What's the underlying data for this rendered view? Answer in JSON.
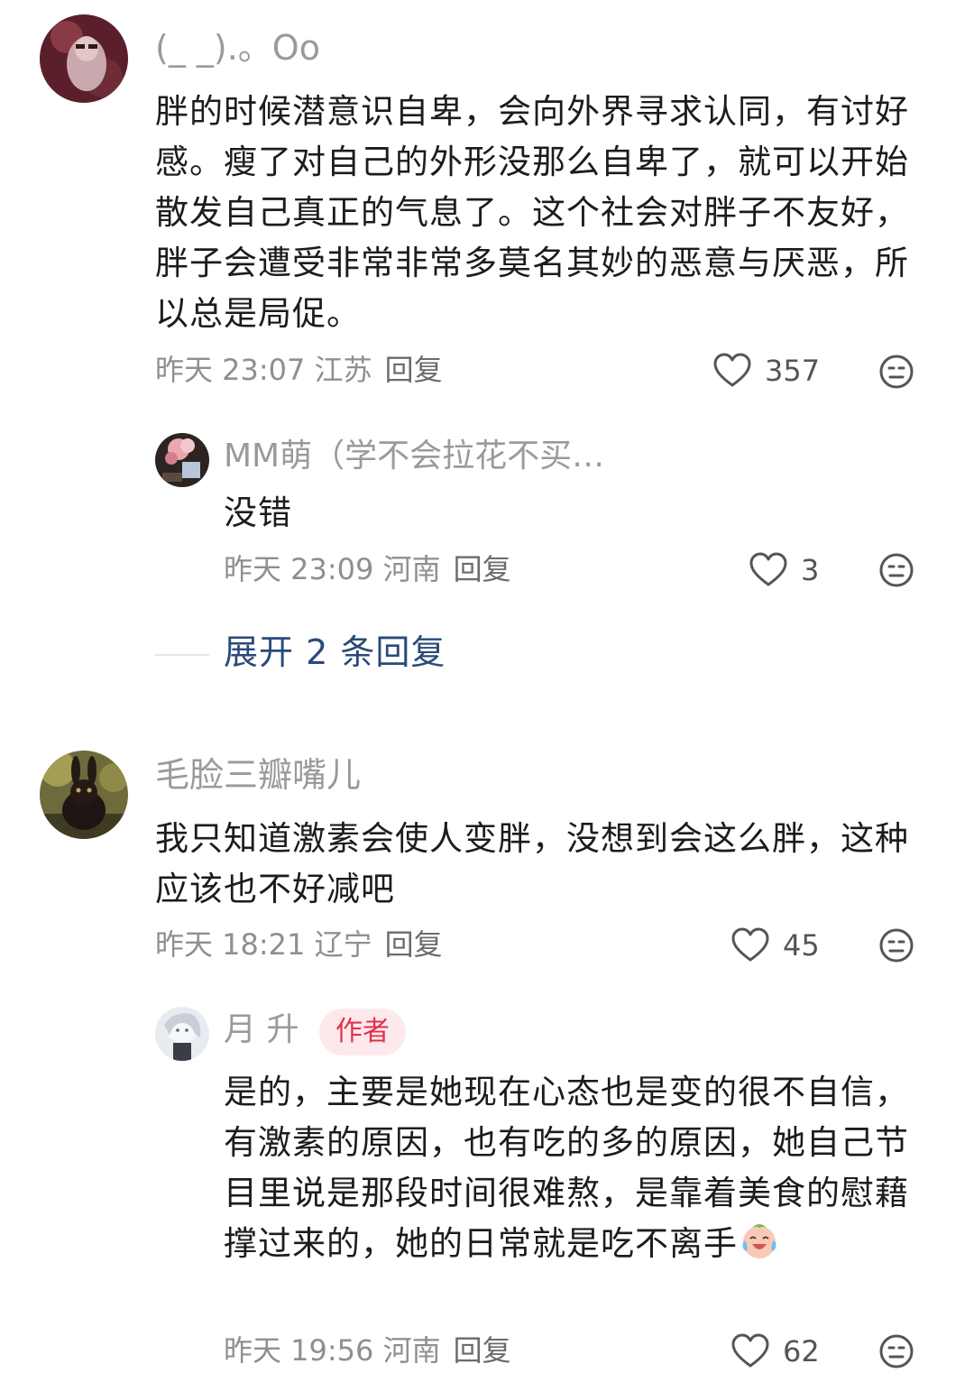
{
  "comments": [
    {
      "username": "(_ _).。Oo",
      "text": "胖的时候潜意识自卑，会向外界寻求认同，有讨好感。瘦了对自己的外形没那么自卑了，就可以开始散发自己真正的气息了。这个社会对胖子不友好，胖子会遭受非常非常多莫名其妙的恶意与厌恶，所以总是局促。",
      "meta": "昨天 23:07 江苏",
      "reply_label": "回复",
      "likes": "357",
      "replies": [
        {
          "username": "MM萌（学不会拉花不买…",
          "text": "没错",
          "meta": "昨天 23:09 河南",
          "reply_label": "回复",
          "likes": "3"
        }
      ],
      "expand_label": "展开 2 条回复"
    },
    {
      "username": "毛脸三瓣嘴儿",
      "text": "我只知道激素会使人变胖，没想到会这么胖，这种应该也不好减吧",
      "meta": "昨天 18:21 辽宁",
      "reply_label": "回复",
      "likes": "45",
      "replies": [
        {
          "username": "月 升",
          "badge": "作者",
          "text": "是的，主要是她现在心态也是变的很不自信，有激素的原因，也有吃的多的原因，她自己节目里说是那段时间很难熬，是靠着美食的慰藉撑过来的，她的日常就是吃不离手",
          "meta": "昨天 19:56 河南",
          "reply_label": "回复",
          "likes": "62"
        }
      ]
    }
  ],
  "icons": {
    "like": "heart-outline-icon",
    "dislike": "neutral-face-icon",
    "emoji": "crying-laughing-emoji"
  },
  "colors": {
    "link": "#2a4a78",
    "badge_bg": "#fde9ec",
    "badge_text": "#e0314b"
  }
}
